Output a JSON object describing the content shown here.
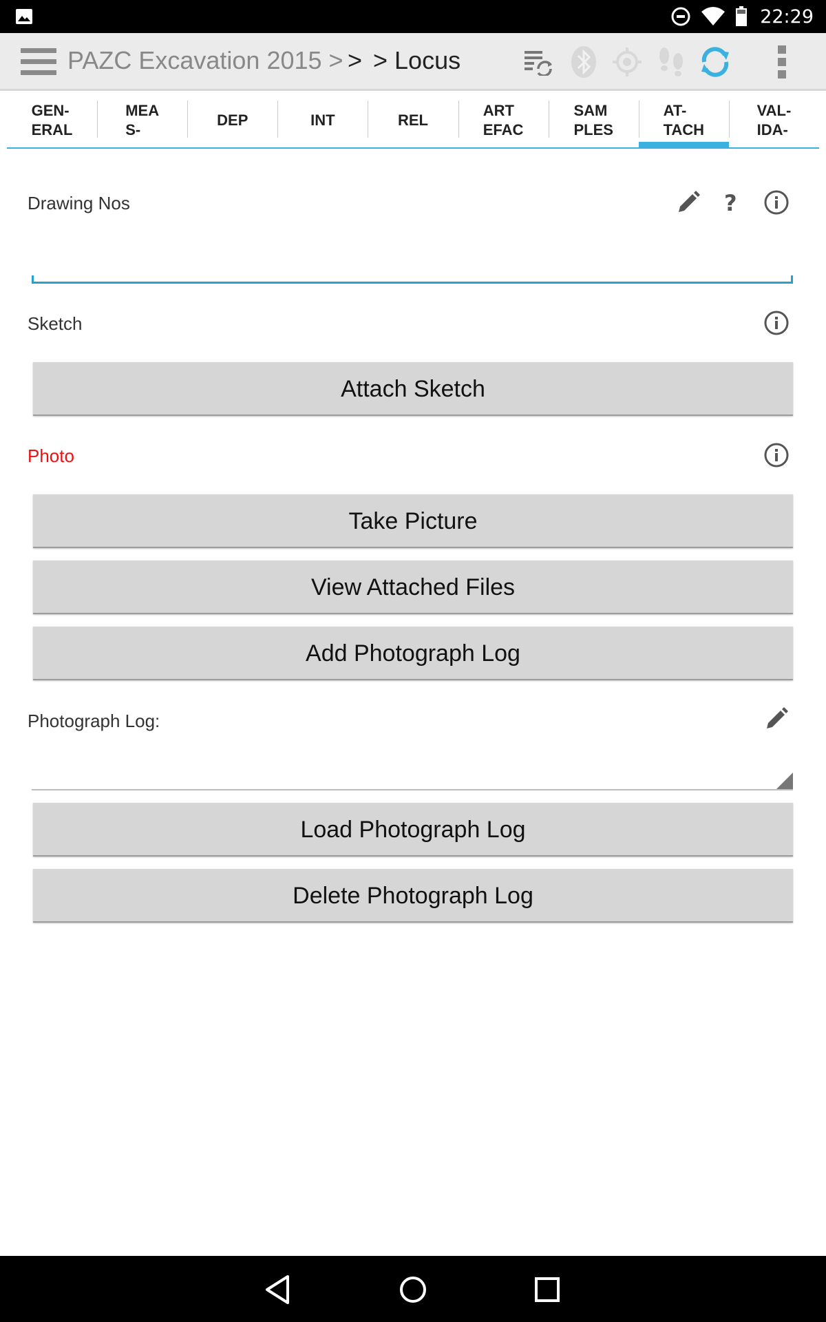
{
  "status_bar": {
    "time": "22:29",
    "icons": [
      "gallery-icon",
      "do-not-disturb-icon",
      "wifi-icon",
      "battery-icon"
    ]
  },
  "action_bar": {
    "project": "PAZC Excavation 2015 >",
    "separator": ">",
    "current": "> Locus",
    "icons": [
      "menu-icon",
      "sync-settings-icon",
      "bluetooth-icon",
      "gps-icon",
      "tracking-icon",
      "sync-icon",
      "overflow-menu-icon"
    ],
    "accent_color": "#3ab1de"
  },
  "tabs": [
    {
      "label": "GEN-\nERAL",
      "active": false
    },
    {
      "label": "MEA\nS-",
      "active": false
    },
    {
      "label": "DEP",
      "active": false
    },
    {
      "label": "INT",
      "active": false
    },
    {
      "label": "REL",
      "active": false
    },
    {
      "label": "ART\nEFAC",
      "active": false
    },
    {
      "label": "SAM\nPLES",
      "active": false
    },
    {
      "label": "AT-\nTACH",
      "active": true
    },
    {
      "label": "VAL-\nIDA-",
      "active": false
    }
  ],
  "form": {
    "drawing_nos": {
      "label": "Drawing Nos",
      "value": "",
      "help": "?"
    },
    "sketch": {
      "label": "Sketch",
      "button": "Attach Sketch"
    },
    "photo": {
      "label": "Photo",
      "label_color": "#ee1111",
      "take_picture": "Take Picture",
      "view_attached": "View Attached Files",
      "add_log": "Add Photograph Log"
    },
    "photograph_log": {
      "label": "Photograph Log:",
      "value": "",
      "load": "Load Photograph Log",
      "delete": "Delete Photograph Log"
    }
  },
  "nav_bar": {
    "icons": [
      "back-icon",
      "home-icon",
      "recents-icon"
    ]
  }
}
